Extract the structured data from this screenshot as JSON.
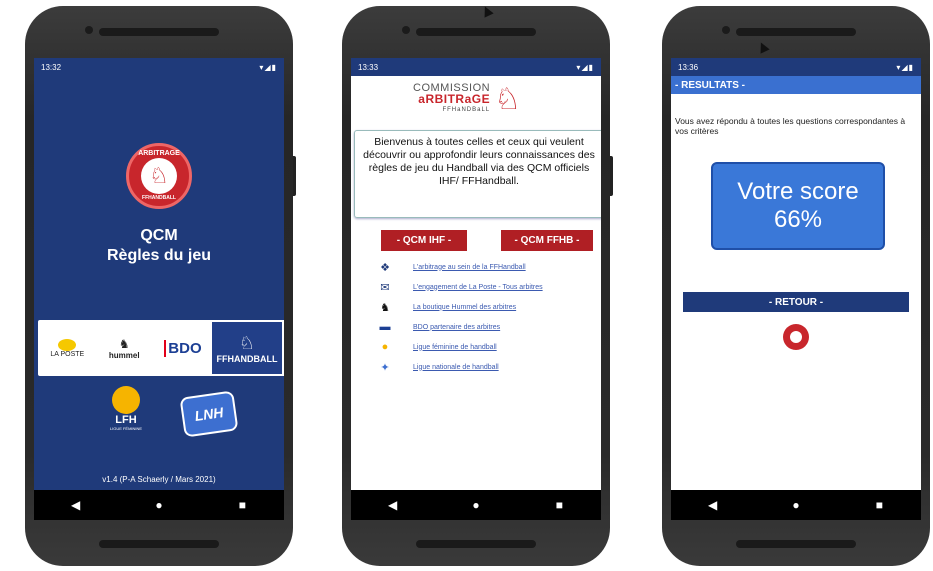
{
  "colors": {
    "ffhb_blue": "#1f3a7a",
    "ffhb_red": "#b01f24",
    "result_blue": "#3a78d8"
  },
  "nav": {
    "back": "◀",
    "home": "●",
    "recent": "■"
  },
  "screen1": {
    "status_time": "13:32",
    "status_icons": "▾◢▮",
    "logo_top_text": "ARBITRAGE",
    "logo_bottom_text": "FFHANDBALL",
    "title_line1": "QCM",
    "title_line2": "Règles du jeu",
    "sponsors": {
      "laposte": "LA POSTE",
      "hummel": "hummel",
      "bdo": "BDO",
      "ffhb": "FFHANDBALL"
    },
    "lfh": {
      "title": "LFH",
      "subtitle": "LIGUE FÉMININE"
    },
    "lnh": "LNH",
    "version": "v1.4 (P-A Schaerly / Mars 2021)"
  },
  "screen2": {
    "status_time": "13:33",
    "status_icons": "▾◢▮",
    "logo": {
      "line1": "COMMISSION",
      "line2": "aRBITRaGE",
      "line3": "FFHaNDBaLL"
    },
    "welcome": "Bienvenus à toutes celles et ceux qui veulent découvrir ou approfondir leurs connaissances des règles de jeu du Handball via des QCM officiels IHF/ FFHandball.",
    "btn_ihf": "- QCM IHF -",
    "btn_ffhb": "- QCM FFHB -",
    "links": [
      {
        "icon": "ffhb-icon",
        "glyph": "❖",
        "label": "L'arbitrage au sein de la FFHandball"
      },
      {
        "icon": "laposte-icon",
        "glyph": "✉",
        "label": "L'engagement de La Poste - Tous arbitres"
      },
      {
        "icon": "hummel-icon",
        "glyph": "♞",
        "label": "La boutique Hummel des arbitres"
      },
      {
        "icon": "bdo-icon",
        "glyph": "▬",
        "label": "BDO partenaire des arbitres"
      },
      {
        "icon": "lfh-icon",
        "glyph": "●",
        "label": "Ligue féminine de handball"
      },
      {
        "icon": "lnh-icon",
        "glyph": "✦",
        "label": "Ligue nationale de handball"
      }
    ]
  },
  "screen3": {
    "status_time": "13:36",
    "status_icons": "▾◢▮",
    "header": "- RESULTATS -",
    "message": "Vous avez répondu à toutes les questions correspondantes à vos critères",
    "score_label": "Votre score",
    "score_value": "66%",
    "retour": "- RETOUR -"
  }
}
